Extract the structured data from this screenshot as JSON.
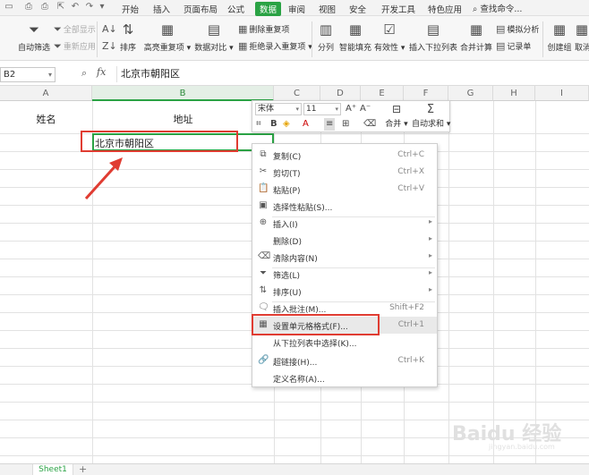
{
  "menubar": {
    "tabs": [
      "开始",
      "插入",
      "页面布局",
      "公式",
      "数据",
      "审阅",
      "视图",
      "安全",
      "开发工具",
      "特色应用"
    ],
    "active_tab": "数据",
    "search": "查找命令..."
  },
  "ribbon": {
    "autofilter": "自动筛选",
    "show_all": "全部显示",
    "reapply": "重新应用",
    "sort": "排序",
    "highlight_dup": "高亮重复项",
    "data_compare": "数据对比",
    "delete_dup": "删除重复项",
    "reject_dup": "拒绝录入重复项",
    "split": "分列",
    "smart_fill": "智能填充",
    "validity": "有效性",
    "insert_dropdown": "插入下拉列表",
    "merge_calc": "合并计算",
    "simulate": "模拟分析",
    "record": "记录单",
    "create_group": "创建组",
    "cancel_group": "取消"
  },
  "formula_bar": {
    "name_box": "B2",
    "fx": "fx",
    "content": "北京市朝阳区"
  },
  "columns": [
    "A",
    "B",
    "C",
    "D",
    "E",
    "F",
    "G",
    "H",
    "I"
  ],
  "cells": {
    "a1": "姓名",
    "b1": "地址",
    "b2": "北京市朝阳区"
  },
  "mini_toolbar": {
    "font": "宋体",
    "size": "11",
    "bold": "B",
    "merge": "合并",
    "autosum": "自动求和"
  },
  "context_menu": {
    "items": [
      {
        "label": "复制(C)",
        "shortcut": "Ctrl+C"
      },
      {
        "label": "剪切(T)",
        "shortcut": "Ctrl+X"
      },
      {
        "label": "粘贴(P)",
        "shortcut": "Ctrl+V"
      },
      {
        "label": "选择性粘贴(S)...",
        "shortcut": ""
      },
      {
        "label": "插入(I)",
        "shortcut": ""
      },
      {
        "label": "删除(D)",
        "shortcut": ""
      },
      {
        "label": "清除内容(N)",
        "shortcut": ""
      },
      {
        "label": "筛选(L)",
        "shortcut": ""
      },
      {
        "label": "排序(U)",
        "shortcut": ""
      },
      {
        "label": "插入批注(M)...",
        "shortcut": "Shift+F2"
      },
      {
        "label": "设置单元格格式(F)...",
        "shortcut": "Ctrl+1"
      },
      {
        "label": "从下拉列表中选择(K)...",
        "shortcut": ""
      },
      {
        "label": "超链接(H)...",
        "shortcut": "Ctrl+K"
      },
      {
        "label": "定义名称(A)...",
        "shortcut": ""
      }
    ],
    "highlighted": "设置单元格格式(F)..."
  },
  "sheet_tabs": {
    "active": "Sheet1",
    "add": "+"
  },
  "watermark": {
    "brand": "Baidu 经验",
    "url": "jingyan.baidu.com"
  },
  "colors": {
    "accent": "#2aa244",
    "annotation": "#e03c32"
  }
}
